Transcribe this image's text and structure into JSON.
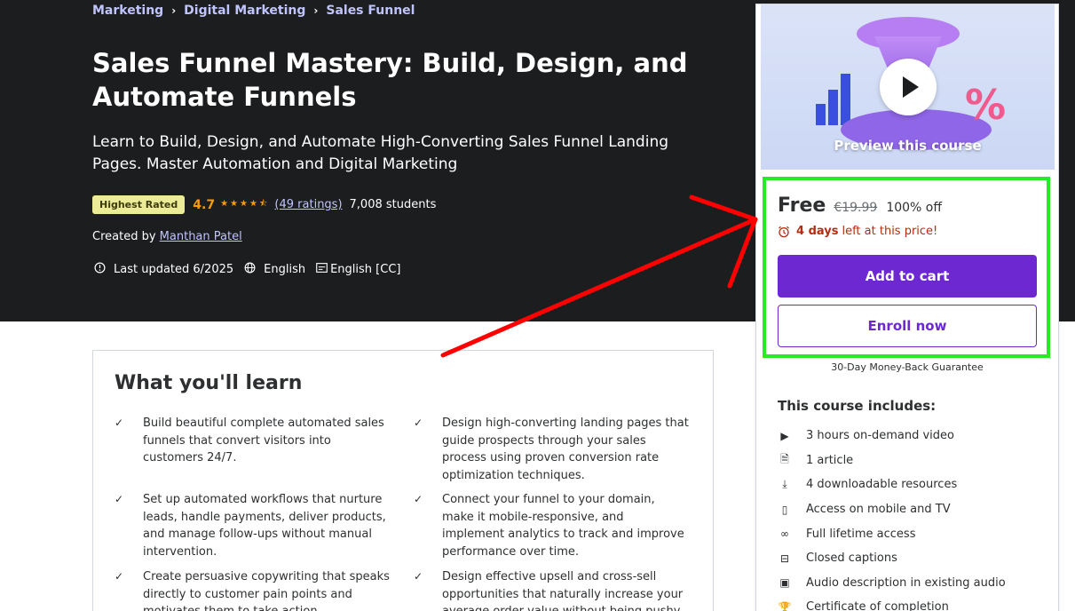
{
  "breadcrumb": [
    "Marketing",
    "Digital Marketing",
    "Sales Funnel"
  ],
  "course": {
    "title": "Sales Funnel Mastery: Build, Design, and Automate Funnels",
    "subtitle": "Learn to Build, Design, and Automate High-Converting Sales Funnel Landing Pages. Master Automation and Digital Marketing",
    "badge": "Highest Rated",
    "rating": "4.7",
    "rating_stars": 4.7,
    "ratings_count": "(49 ratings)",
    "students": "7,008 students",
    "created_by_label": "Created by",
    "instructor": "Manthan Patel",
    "last_updated": "Last updated 6/2025",
    "language": "English",
    "captions": "English [CC]"
  },
  "card": {
    "preview_label": "Preview this course",
    "price": "Free",
    "original_price": "€19.99",
    "discount": "100% off",
    "deadline_bold": "4 days",
    "deadline_rest": "left at this price!",
    "add_to_cart": "Add to cart",
    "enroll_now": "Enroll now",
    "guarantee": "30-Day Money-Back Guarantee",
    "includes_title": "This course includes:",
    "includes": [
      {
        "icon": "video-icon",
        "label": "3 hours on-demand video"
      },
      {
        "icon": "article-icon",
        "label": "1 article"
      },
      {
        "icon": "download-icon",
        "label": "4 downloadable resources"
      },
      {
        "icon": "mobile-icon",
        "label": "Access on mobile and TV"
      },
      {
        "icon": "infinity-icon",
        "label": "Full lifetime access"
      },
      {
        "icon": "captions-icon",
        "label": "Closed captions"
      },
      {
        "icon": "audio-description-icon",
        "label": "Audio description in existing audio"
      },
      {
        "icon": "trophy-icon",
        "label": "Certificate of completion"
      }
    ]
  },
  "learn": {
    "title": "What you'll learn",
    "items": [
      "Build beautiful complete automated sales funnels that convert visitors into customers 24/7.",
      "Design high-converting landing pages that guide prospects through your sales process using proven conversion rate optimization techniques.",
      "Set up automated workflows that nurture leads, handle payments, deliver products, and manage follow-ups without manual intervention.",
      "Connect your funnel to your domain, make it mobile-responsive, and implement analytics to track and improve performance over time.",
      "Create persuasive copywriting that speaks directly to customer pain points and motivates them to take action immediately.",
      "Design effective upsell and cross-sell opportunities that naturally increase your average order value without being pushy."
    ]
  },
  "colors": {
    "hero_bg": "#1c1d1f",
    "link": "#c0c4fc",
    "star": "#f69c08",
    "primary": "#6d28d2",
    "urgent": "#b32d0f",
    "highlight": "#22ee22",
    "arrow": "#ff0000"
  }
}
